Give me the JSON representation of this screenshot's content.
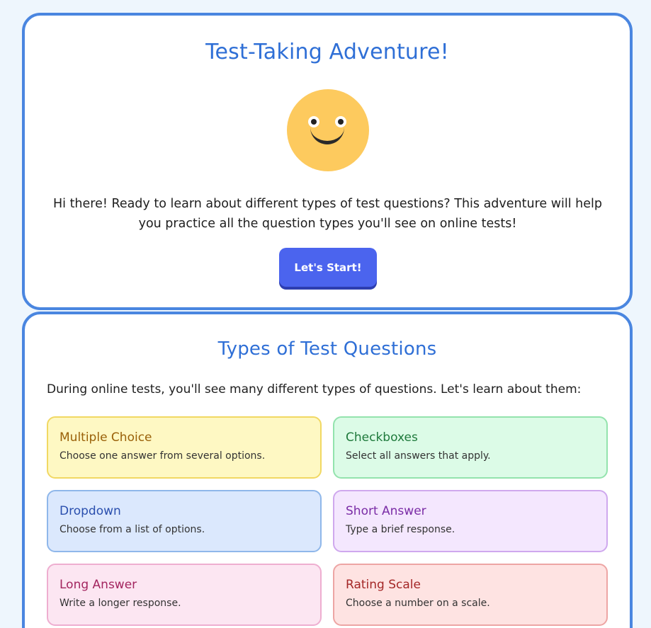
{
  "intro": {
    "title": "Test-Taking Adventure!",
    "text": "Hi there! Ready to learn about different types of test questions? This adventure will help you practice all the question types you'll see on online tests!",
    "start_button": "Let's Start!"
  },
  "types": {
    "title": "Types of Test Questions",
    "intro": "During online tests, you'll see many different types of questions. Let's learn about them:",
    "items": [
      {
        "name": "Multiple Choice",
        "desc": "Choose one answer from several options."
      },
      {
        "name": "Checkboxes",
        "desc": "Select all answers that apply."
      },
      {
        "name": "Dropdown",
        "desc": "Choose from a list of options."
      },
      {
        "name": "Short Answer",
        "desc": "Type a brief response."
      },
      {
        "name": "Long Answer",
        "desc": "Write a longer response."
      },
      {
        "name": "Rating Scale",
        "desc": "Choose a number on a scale."
      }
    ]
  },
  "colors": {
    "accent": "#4a86e0",
    "title": "#2f6fd6",
    "button": "#4b64ee",
    "smiley": "#fdca5e"
  },
  "icons": {
    "mascot": "smiley-face-icon"
  }
}
